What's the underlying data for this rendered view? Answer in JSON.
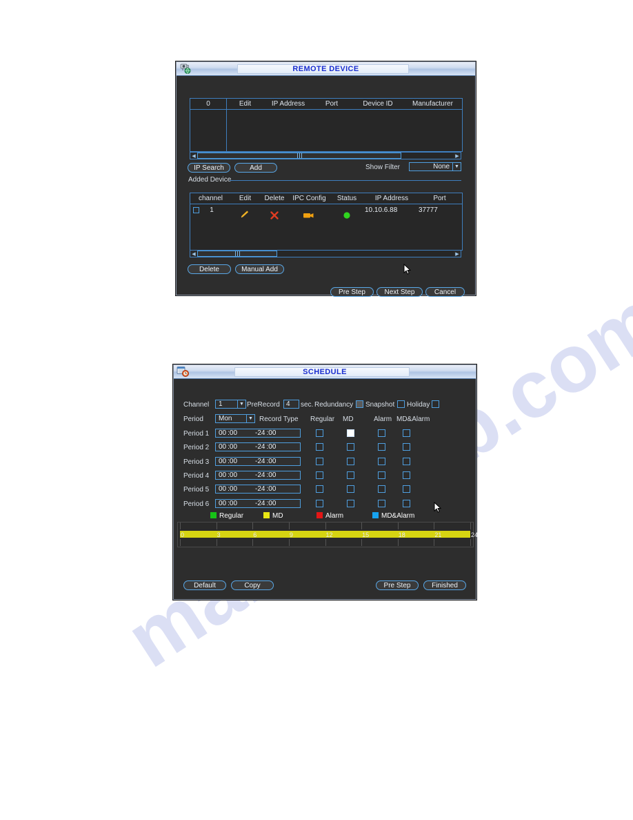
{
  "page": {
    "watermark": "manualslib.com"
  },
  "remote_device": {
    "title": "REMOTE DEVICE",
    "title_icon": "network-camera-icon",
    "search_table": {
      "headers": [
        "0",
        "Edit",
        "IP Address",
        "Port",
        "Device ID",
        "Manufacturer"
      ],
      "rows": []
    },
    "buttons": {
      "ip_search": "IP Search",
      "add": "Add"
    },
    "show_filter_label": "Show Filter",
    "show_filter_value": "None",
    "added_device": {
      "group_label": "Added Device",
      "headers": [
        "channel",
        "Edit",
        "Delete",
        "IPC Config",
        "Status",
        "IP Address",
        "Port"
      ],
      "rows": [
        {
          "selected": false,
          "channel": "1",
          "edit": "pencil-icon",
          "delete": "x-icon",
          "ipc_config": "camera-icon",
          "status": "status-ok-dot",
          "ip_address": "10.10.6.88",
          "port": "37777"
        }
      ],
      "buttons": {
        "delete": "Delete",
        "manual_add": "Manual Add"
      }
    },
    "footer_buttons": {
      "pre_step": "Pre Step",
      "next_step": "Next Step",
      "cancel": "Cancel"
    }
  },
  "schedule": {
    "title": "SCHEDULE",
    "title_icon": "calendar-clock-icon",
    "channel_label": "Channel",
    "channel_value": "1",
    "prerecord_label": "PreRecord",
    "prerecord_value": "4",
    "sec_label": "sec.",
    "redundancy_label": "Redundancy",
    "redundancy_checked": false,
    "snapshot_label": "Snapshot",
    "snapshot_checked": false,
    "holiday_label": "Holiday",
    "holiday_checked": false,
    "period_label": "Period",
    "period_value": "Mon",
    "record_type_label": "Record Type",
    "type_headers": [
      "Regular",
      "MD",
      "Alarm",
      "MD&Alarm"
    ],
    "periods": [
      {
        "label": "Period 1",
        "start_h": "00",
        "start_m": "00",
        "end_h": "24",
        "end_m": "00",
        "regular": false,
        "md": true,
        "alarm": false,
        "md_alarm": false
      },
      {
        "label": "Period 2",
        "start_h": "00",
        "start_m": "00",
        "end_h": "24",
        "end_m": "00",
        "regular": false,
        "md": false,
        "alarm": false,
        "md_alarm": false
      },
      {
        "label": "Period 3",
        "start_h": "00",
        "start_m": "00",
        "end_h": "24",
        "end_m": "00",
        "regular": false,
        "md": false,
        "alarm": false,
        "md_alarm": false
      },
      {
        "label": "Period 4",
        "start_h": "00",
        "start_m": "00",
        "end_h": "24",
        "end_m": "00",
        "regular": false,
        "md": false,
        "alarm": false,
        "md_alarm": false
      },
      {
        "label": "Period 5",
        "start_h": "00",
        "start_m": "00",
        "end_h": "24",
        "end_m": "00",
        "regular": false,
        "md": false,
        "alarm": false,
        "md_alarm": false
      },
      {
        "label": "Period 6",
        "start_h": "00",
        "start_m": "00",
        "end_h": "24",
        "end_m": "00",
        "regular": false,
        "md": false,
        "alarm": false,
        "md_alarm": false
      }
    ],
    "legend": [
      {
        "label": "Regular",
        "color": "#17c217"
      },
      {
        "label": "MD",
        "color": "#e8e614"
      },
      {
        "label": "Alarm",
        "color": "#e31616"
      },
      {
        "label": "MD&Alarm",
        "color": "#17a3f0"
      }
    ],
    "timeline": {
      "ticks": [
        "0",
        "3",
        "6",
        "9",
        "12",
        "15",
        "18",
        "21",
        "24"
      ],
      "bar_color": "#d6d412",
      "bar_start": 0,
      "bar_end": 24,
      "range": [
        0,
        24
      ]
    },
    "buttons": {
      "default": "Default",
      "copy": "Copy",
      "pre_step": "Pre Step",
      "finished": "Finished"
    }
  }
}
